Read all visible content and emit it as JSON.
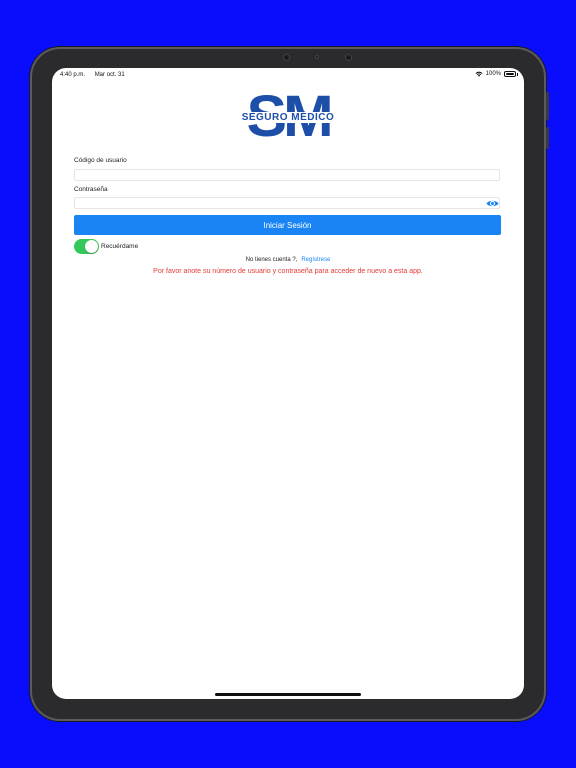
{
  "status_bar": {
    "time": "4:40 p.m.",
    "date": "Mar oct. 31",
    "battery": "100%"
  },
  "logo": {
    "initials": "SM",
    "text": "SEGURO MÉDICO",
    "color": "#1d4fa8"
  },
  "form": {
    "user_label": "Código de usuario",
    "user_value": "",
    "password_label": "Contraseña",
    "password_value": "",
    "login_button": "Iniciar Sesión",
    "remember_label": "Recuérdame",
    "remember_on": true,
    "no_account_text": "No tienes cuenta ?,",
    "register_link": "Regístrese",
    "warning_message": "Por favor anote su número de usuario y contraseña para acceder de nuevo a esta app."
  },
  "colors": {
    "background": "#0a0dfb",
    "accent": "#1b84f5",
    "toggle_on": "#34c759",
    "warning": "#e53935"
  },
  "icons": {
    "wifi": "wifi-icon",
    "battery": "battery-icon",
    "password_visibility": "eye-icon"
  }
}
